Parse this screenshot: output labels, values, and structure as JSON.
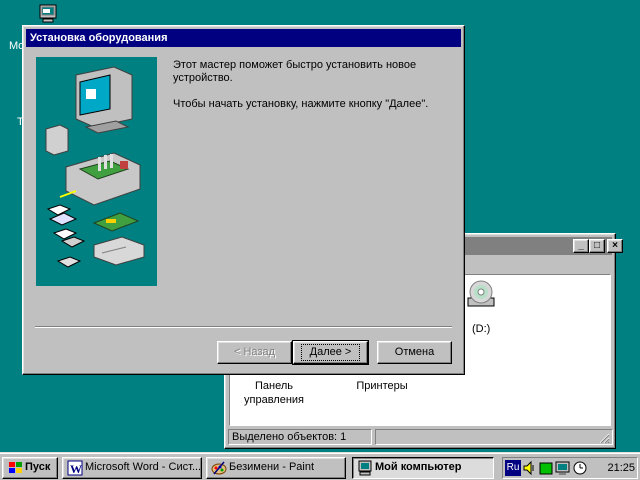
{
  "desktop": {
    "clipped_label_1": "Mo",
    "clipped_label_2": "T"
  },
  "explorer": {
    "title": "",
    "buttons": {
      "minimize": "_",
      "maximize": "□",
      "close": "×"
    },
    "items": [
      {
        "label_line1": "(D:)",
        "label_line2": ""
      },
      {
        "label_line1": "Панель",
        "label_line2": "управления"
      },
      {
        "label_line1": "Принтеры",
        "label_line2": ""
      }
    ],
    "status": "Выделено объектов: 1"
  },
  "wizard": {
    "title": "Установка оборудования",
    "paragraph1": "Этот мастер поможет быстро установить новое устройство.",
    "paragraph2": "Чтобы начать установку, нажмите кнопку \"Далее\".",
    "back_button": "< Назад",
    "next_button": "Далее >",
    "cancel_button": "Отмена"
  },
  "taskbar": {
    "start_label": "Пуск",
    "tasks": [
      {
        "label": "Microsoft Word - Сист...",
        "icon": "word-icon"
      },
      {
        "label": "Безимени - Paint",
        "icon": "paint-icon"
      },
      {
        "label": "Мой компьютер",
        "icon": "computer-icon",
        "active": true
      }
    ],
    "tray": {
      "language": "Ru",
      "clock": "21:25"
    }
  }
}
